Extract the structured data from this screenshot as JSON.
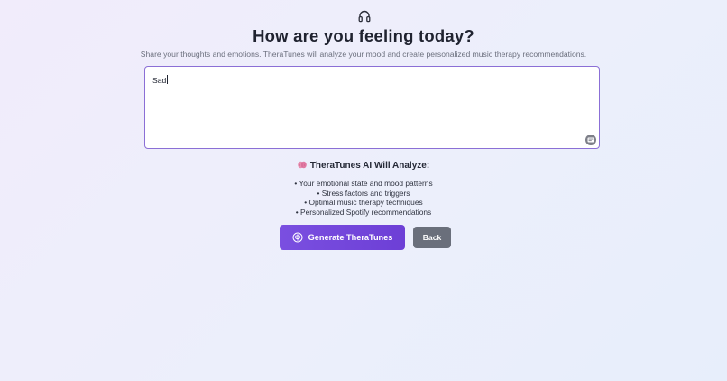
{
  "header": {
    "icon": "headphones-icon",
    "title": "How are you feeling today?",
    "subtitle": "Share your thoughts and emotions. TheraTunes will analyze your mood and create personalized music therapy recommendations."
  },
  "mood_input": {
    "value": "Sad",
    "assist_icon": "grammar-assist-icon"
  },
  "analysis": {
    "icon": "brain-icon",
    "heading": "TheraTunes AI Will Analyze:",
    "items": [
      "• Your emotional state and mood patterns",
      "• Stress factors and triggers",
      "• Optimal music therapy techniques",
      "• Personalized Spotify recommendations"
    ]
  },
  "actions": {
    "generate_label": "Generate TheraTunes",
    "generate_icon": "brain-outline-icon",
    "back_label": "Back"
  },
  "colors": {
    "accent": "#6d3fd6",
    "input_border": "#8b6fd6",
    "back_button": "#6a6f7b"
  }
}
